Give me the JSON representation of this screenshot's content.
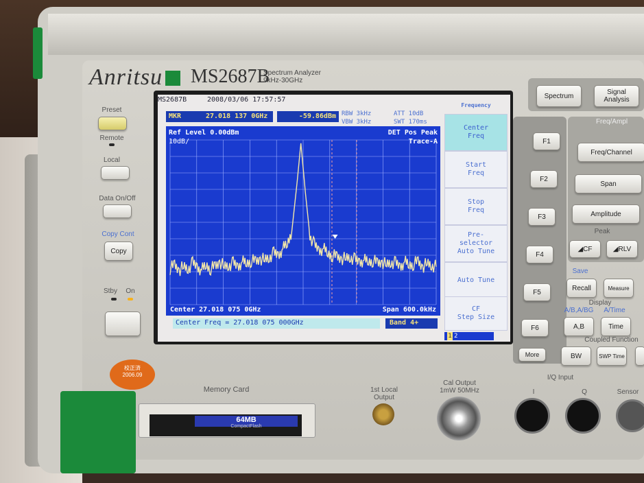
{
  "brand": {
    "logo": "Anritsu",
    "model": "MS2687B",
    "subtitle_line1": "Spectrum Analyzer",
    "subtitle_line2": "9kHz-30GHz"
  },
  "screen": {
    "model": "MS2687B",
    "datetime": "2008/03/06   17:57:57",
    "marker_label": "MKR",
    "marker_freq": "27.018 137 0GHz",
    "marker_level": "-59.86dBm",
    "rbw": "RBW 3kHz",
    "vbw": "VBW 3kHz",
    "att": "ATT 10dB",
    "swt": "SWT 170ms",
    "ref_level": "Ref Level  0.00dBm",
    "scale": "10dB/",
    "det": "DET  Pos Peak",
    "trace": "Trace-A",
    "center": "Center 27.018 075 0GHz",
    "span": "Span 600.0kHz",
    "entry": "Center Freq = 27.018 075 000GHz",
    "band": "Band 4+",
    "menu_title": "Frequency",
    "menu_items": [
      {
        "label": "Center\nFreq",
        "active": true
      },
      {
        "label": "Start\nFreq",
        "active": false
      },
      {
        "label": "Stop\nFreq",
        "active": false
      },
      {
        "label": "Pre-\nselector\nAuto Tune",
        "active": false
      },
      {
        "label": "Auto Tune",
        "active": false
      },
      {
        "label": "CF\nStep Size",
        "active": false
      }
    ],
    "page_current": "1",
    "page_next": "2",
    "trace_color": "#f3e7a8",
    "plot_color": "#1a3bcf"
  },
  "left_panel": {
    "preset": "Preset",
    "remote": "Remote",
    "local": "Local",
    "data_onoff": "Data On/Off",
    "copy_cont": "Copy Cont",
    "copy": "Copy",
    "stby": "Stby",
    "on": "On",
    "sticker": "校正済\n2006.09"
  },
  "fkeys": [
    "F1",
    "F2",
    "F3",
    "F4",
    "F5",
    "F6",
    "More"
  ],
  "right_panel": {
    "spectrum": "Spectrum",
    "signal_analysis": "Signal\nAnalysis",
    "freq_ampl": "Freq/Ampl",
    "freq_channel": "Freq/Channel",
    "span": "Span",
    "amplitude": "Amplitude",
    "peak": "Peak",
    "peak_cf": "CF",
    "peak_rlv": "RLV",
    "save": "Save",
    "recall": "Recall",
    "measure": "Measure",
    "display": "Display",
    "ab_ag": "A/B,A/BG",
    "a_time": "A/Time",
    "ab": "A,B",
    "time": "Time",
    "coupled": "Coupled Function",
    "bw": "BW",
    "swp_time": "SWP Time",
    "iq_input": "I/Q Input",
    "i": "I",
    "q": "Q",
    "sensor": "Sensor"
  },
  "bottom": {
    "memory_card": "Memory Card",
    "card_label": "64MB",
    "card_sub": "CompactFlash",
    "first_local": "1st Local\nOutput",
    "cal_output": "Cal Output\n1mW 50MHz"
  },
  "chart_data": {
    "type": "line",
    "title": "",
    "xlabel": "",
    "ylabel": "",
    "x_range": [
      "Center 27.018 075 0GHz - 300kHz",
      "+300kHz"
    ],
    "y_range_dbm": [
      -100,
      0
    ],
    "grid": true,
    "series": [
      {
        "values_dbm": [
          -78,
          -76,
          -79,
          -77,
          -78,
          -75,
          -77,
          -79,
          -76,
          -78,
          -77,
          -74,
          -77,
          -76,
          -75,
          -77,
          -74,
          -75,
          -73,
          -74,
          -72,
          -73,
          -71,
          -69,
          -70,
          -66,
          -63,
          -55,
          -30,
          -2,
          -32,
          -58,
          -64,
          -67,
          -66,
          -69,
          -70,
          -71,
          -72,
          -72,
          -71,
          -73,
          -74,
          -73,
          -74,
          -73,
          -75,
          -74,
          -76,
          -74,
          -75,
          -77,
          -74,
          -76,
          -75,
          -74,
          -77,
          -75,
          -76,
          -77
        ]
      }
    ]
  }
}
